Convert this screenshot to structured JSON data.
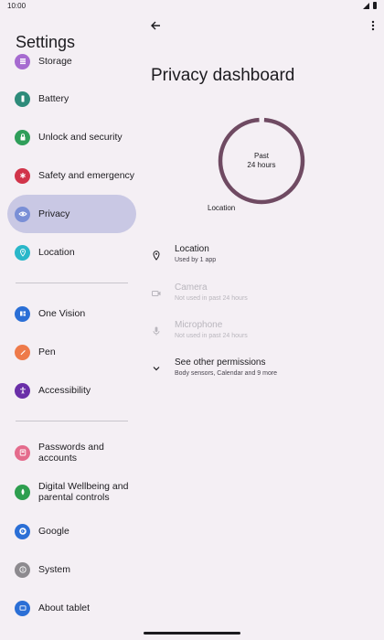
{
  "status": {
    "time": "10:00"
  },
  "left": {
    "title": "Settings",
    "items": [
      {
        "label": "Storage",
        "icon": "storage-icon",
        "color": "#a66bd0"
      },
      {
        "label": "Battery",
        "icon": "battery-icon",
        "color": "#2e8b7a"
      },
      {
        "label": "Unlock and security",
        "icon": "lock-icon",
        "color": "#2f9e5a"
      },
      {
        "label": "Safety and emergency",
        "icon": "asterisk-icon",
        "color": "#d1344a"
      },
      {
        "label": "Privacy",
        "icon": "eye-icon",
        "color": "#7a8fd6"
      },
      {
        "label": "Location",
        "icon": "location-pin-icon",
        "color": "#2ab7c9"
      },
      {
        "label": "One Vision",
        "icon": "one-vision-icon",
        "color": "#2b6fd6"
      },
      {
        "label": "Pen",
        "icon": "pen-icon",
        "color": "#ee7a4a"
      },
      {
        "label": "Accessibility",
        "icon": "accessibility-icon",
        "color": "#6a2fa8"
      },
      {
        "label": "Passwords and accounts",
        "icon": "account-icon",
        "color": "#e46b8c"
      },
      {
        "label": "Digital Wellbeing and parental controls",
        "icon": "wellbeing-icon",
        "color": "#2e9e4f"
      },
      {
        "label": "Google",
        "icon": "google-icon",
        "color": "#ffffff"
      },
      {
        "label": "System",
        "icon": "info-icon",
        "color": "#8d8a8f"
      },
      {
        "label": "About tablet",
        "icon": "tablet-icon",
        "color": "#2b6fd6"
      }
    ]
  },
  "right": {
    "title": "Privacy dashboard",
    "donut": {
      "line1": "Past",
      "line2": "24 hours",
      "legend": "Location",
      "color": "#6f4a62",
      "location_share": 1.0
    },
    "permissions": [
      {
        "title": "Location",
        "subtitle": "Used by 1 app"
      },
      {
        "title": "Camera",
        "subtitle": "Not used in past 24 hours"
      },
      {
        "title": "Microphone",
        "subtitle": "Not used in past 24 hours"
      },
      {
        "title": "See other permissions",
        "subtitle": "Body sensors, Calendar and 9 more"
      }
    ]
  }
}
